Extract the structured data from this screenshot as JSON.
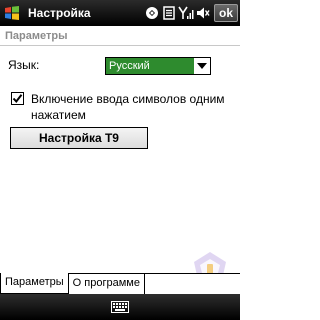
{
  "titlebar": {
    "title": "Настройка",
    "ok_label": "ok",
    "status_icons": [
      "connectivity-icon",
      "notification-icon",
      "signal-icon",
      "speaker-mute-icon"
    ]
  },
  "page": {
    "heading": "Параметры"
  },
  "language": {
    "label": "Язык:",
    "selected": "Русский"
  },
  "symbol_input": {
    "checked": true,
    "label": "Включение ввода символов одним нажатием"
  },
  "t9_button": {
    "label": "Настройка T9"
  },
  "tabs": [
    {
      "label": "Параметры",
      "active": true
    },
    {
      "label": "О программе",
      "active": false
    }
  ],
  "menubar": {
    "icon": "keyboard-icon"
  },
  "colors": {
    "titlebar": "#000000",
    "selection": "#2e8b2e",
    "heading_text": "#8c8c8c"
  }
}
